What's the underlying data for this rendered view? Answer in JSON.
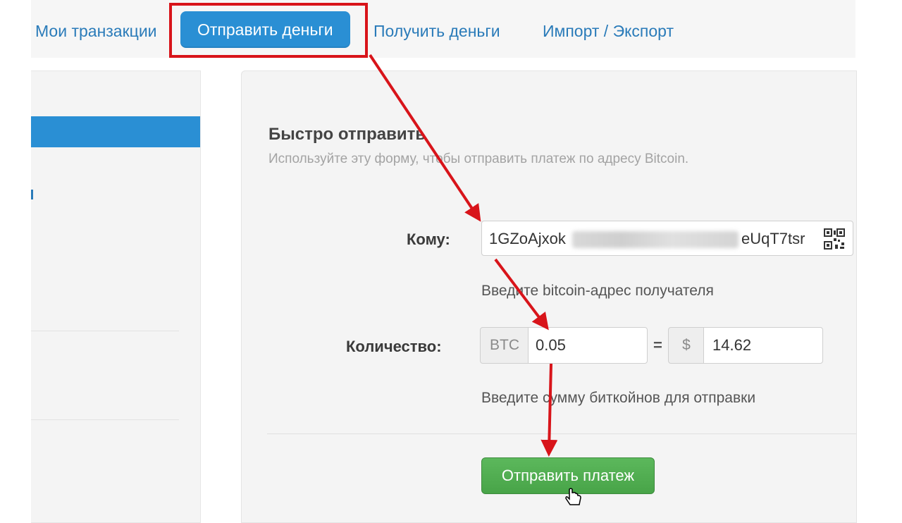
{
  "nav": {
    "tabs": [
      {
        "label": "Мои транзакции"
      },
      {
        "label": "Отправить деньги",
        "active": true
      },
      {
        "label": "Получить деньги"
      },
      {
        "label": "Импорт / Экспорт"
      }
    ]
  },
  "form": {
    "title": "Быстро отправить",
    "subtitle": "Используйте эту форму, чтобы отправить платеж по адресу Bitcoin.",
    "to_label": "Кому:",
    "address_start": "1GZoAjxok",
    "address_end": "eUqT7tsr",
    "address_help": "Введите bitcoin-адрес получателя",
    "amount_label": "Количество:",
    "btc_addon": "BTC",
    "btc_value": "0.05",
    "equals": "=",
    "usd_addon": "$",
    "usd_value": "14.62",
    "amount_help": "Введите сумму биткойнов для отправки",
    "send_button": "Отправить платеж"
  },
  "colors": {
    "accent": "#2a8fd4",
    "link": "#2a7bb9",
    "annotation": "#d8141a",
    "button": "#5cb85c"
  },
  "icons": [
    "qr-code-icon",
    "hand-cursor-icon"
  ]
}
